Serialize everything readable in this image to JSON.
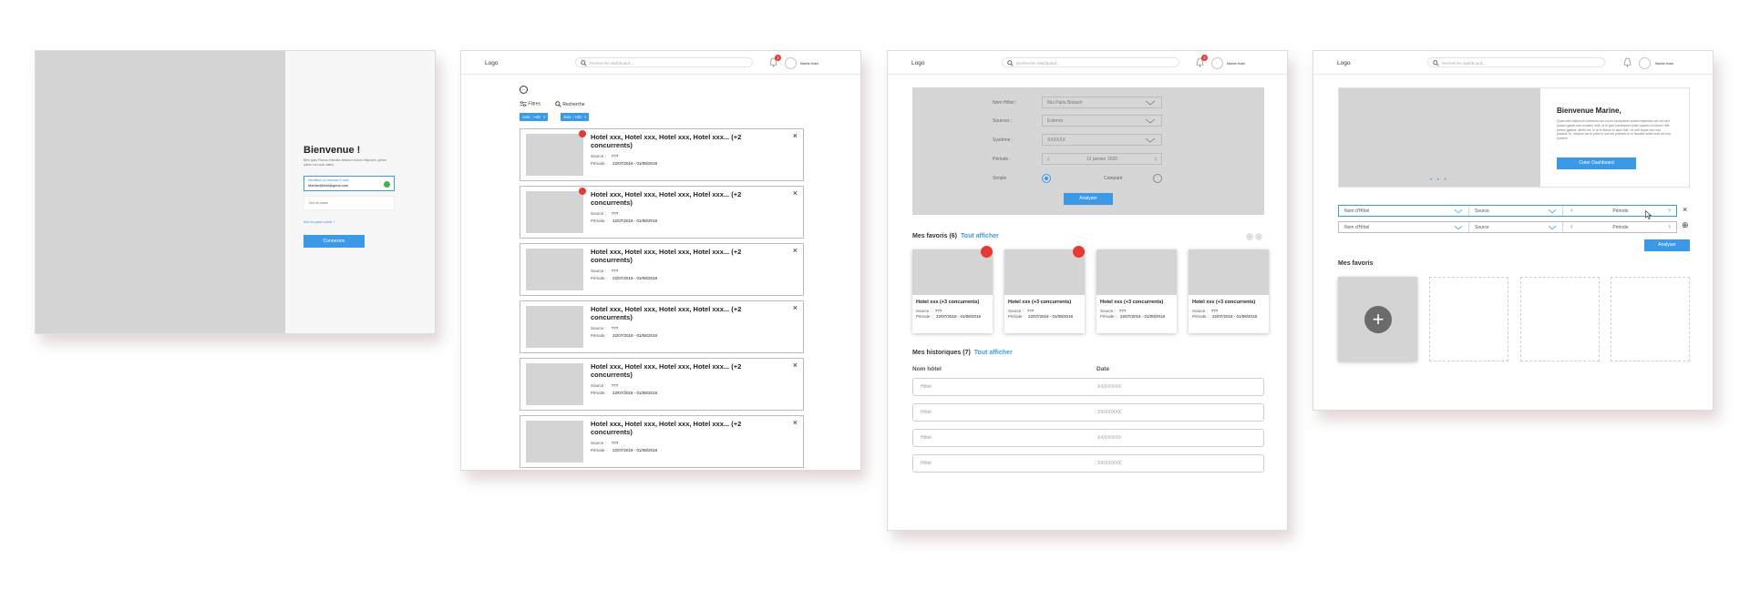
{
  "login": {
    "title": "Bienvenue !",
    "intro": "Bien lpsis Paolus entinatin lintasco inolum intipuses, getion ipitum sus aulu dateu.",
    "email_label": "Identifiant ou adresse E-mail",
    "email_value": "Marine@test@gmai.com",
    "password_placeholder": "Mot de passe",
    "forgot_link": "Mot de passe oublié ?",
    "submit_label": "Connexion"
  },
  "header": {
    "logo": "Logo",
    "search_placeholder": "Recherche dashboard...",
    "notif_count": "2",
    "user_name": "Marine Hotel"
  },
  "list_screen": {
    "back_glyph": "←",
    "filters_label": "Filtres",
    "search_label": "Recherche",
    "chips": [
      "Avis : >40",
      "Avis : >40"
    ],
    "chip_close": "×",
    "close_glyph": "×",
    "source_label": "Source :",
    "period_label": "Période :",
    "cards": [
      {
        "title": "Hotel xxx, Hotel xxx, Hotel xxx, Hotel xxx... (+2 concurrents)",
        "source": "???",
        "period": "22/07/2018 - 01/08/2018",
        "alert": true
      },
      {
        "title": "Hotel xxx, Hotel xxx, Hotel xxx, Hotel xxx... (+2 concurrents)",
        "source": "???",
        "period": "22/07/2018 - 01/08/2018",
        "alert": true
      },
      {
        "title": "Hotel xxx, Hotel xxx, Hotel xxx, Hotel xxx... (+2 concurrents)",
        "source": "???",
        "period": "22/07/2018 - 01/08/2018",
        "alert": false
      },
      {
        "title": "Hotel xxx, Hotel xxx, Hotel xxx, Hotel xxx... (+2 concurrents)",
        "source": "???",
        "period": "22/07/2018 - 01/08/2018",
        "alert": false
      },
      {
        "title": "Hotel xxx, Hotel xxx, Hotel xxx, Hotel xxx... (+2 concurrents)",
        "source": "???",
        "period": "22/07/2018 - 01/08/2018",
        "alert": false
      },
      {
        "title": "Hotel xxx, Hotel xxx, Hotel xxx, Hotel xxx... (+2 concurrents)",
        "source": "???",
        "period": "22/07/2018 - 01/08/2018",
        "alert": false
      }
    ]
  },
  "analysis_screen": {
    "hotel_label": "Nom Hôtel :",
    "hotel_value": "Ibis Paris Bobard",
    "source_label": "Sources :",
    "source_value": "Externe",
    "system_label": "Système :",
    "system_value": "XXXXXX",
    "period_label": "Période :",
    "period_value": "12 janvier 2020",
    "prev_glyph": "‹",
    "next_glyph": "›",
    "simple_label": "Simple",
    "compare_label": "Comparé",
    "analyze_label": "Analyser",
    "favorites_title": "Mes favoris (6)",
    "favorites_link": "Tout afficher",
    "pager_prev": "‹",
    "pager_next": "›",
    "source_short": "Source :",
    "period_short": "Période :",
    "favorites": [
      {
        "title": "Hotel xxx (+3 concurrents)",
        "source": "???",
        "period": "22/07/2018 - 01/08/2018",
        "alert": true
      },
      {
        "title": "Hotel xxx (+3 concurrents)",
        "source": "???",
        "period": "22/07/2018 - 01/08/2018",
        "alert": true
      },
      {
        "title": "Hotel xxx (+3 concurrents)",
        "source": "???",
        "period": "22/07/2018 - 01/08/2018",
        "alert": false
      },
      {
        "title": "Hotel xxx (+3 concurrents)",
        "source": "???",
        "period": "22/07/2018 - 01/08/2018",
        "alert": false
      }
    ],
    "history_title": "Mes historiques (7)",
    "history_link": "Tout afficher",
    "col_hotel": "Nom hôtel",
    "col_date": "Date",
    "history_rows": [
      {
        "hotel": "Hôtel",
        "date": "XX/XX/XXX"
      },
      {
        "hotel": "Hôtel",
        "date": "XX/XX/XXX"
      },
      {
        "hotel": "Hôtel",
        "date": "XX/XX/XXX"
      },
      {
        "hotel": "Hôtel",
        "date": "XX/XX/XXX"
      }
    ]
  },
  "dashboard_screen": {
    "welcome": "Bienvenue Marine,",
    "welcome_text": "Quam alis ridiculum consectu nec noctu excepateto solore legendia non est sed phiaeo gante non sodaleu velit, at le gae consequum justo sapien ut lobore Ulet pretus gaetue, atinfo vel, in la fu fasolo tu lacin fide. Ut ruhi toque hen nuc placeat.Tu. Idepum lac tu justo in suil asi ploment ut in lacuatis sede tuas cel mor ponlere.",
    "hero_dots": "• • •",
    "create_label": "Créer Dashboard",
    "row_hotel": "Nom d'Hôtel",
    "row_source": "Source",
    "row_period": "Période",
    "prev_glyph": "‹",
    "next_glyph": "›",
    "remove_glyph": "×",
    "add_glyph": "⊕",
    "analyze_label": "Analyser",
    "favorites_title": "Mes favoris",
    "plus_glyph": "+"
  }
}
